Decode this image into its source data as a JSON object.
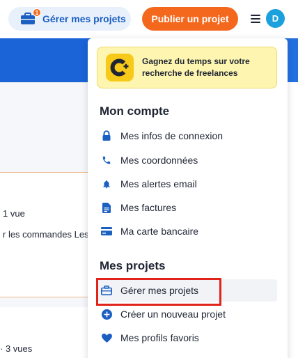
{
  "header": {
    "manage_label": "Gérer mes projets",
    "manage_badge": "1",
    "publish_label": "Publier un projet",
    "avatar_initial": "D"
  },
  "background": {
    "views_1": "1 vue",
    "snippet_1": "r les commandes Les",
    "views_2": "· 3 vues"
  },
  "menu": {
    "promo_text": "Gagnez du temps sur votre recherche de freelances",
    "account_title": "Mon compte",
    "account_items": [
      {
        "label": "Mes infos de connexion",
        "icon": "lock-icon"
      },
      {
        "label": "Mes coordonnées",
        "icon": "phone-icon"
      },
      {
        "label": "Mes alertes email",
        "icon": "bell-icon"
      },
      {
        "label": "Mes factures",
        "icon": "invoice-icon"
      },
      {
        "label": "Ma carte bancaire",
        "icon": "credit-card-icon"
      }
    ],
    "projects_title": "Mes projets",
    "project_items": [
      {
        "label": "Gérer mes projets",
        "icon": "briefcase-icon",
        "active": true
      },
      {
        "label": "Créer un nouveau projet",
        "icon": "plus-circle-icon"
      },
      {
        "label": "Mes profils favoris",
        "icon": "heart-icon"
      }
    ]
  },
  "colors": {
    "primary_blue": "#1b5fc1",
    "accent_orange": "#f4681d",
    "highlight_red": "#e0231b",
    "promo_yellow": "#fdf5b0"
  }
}
